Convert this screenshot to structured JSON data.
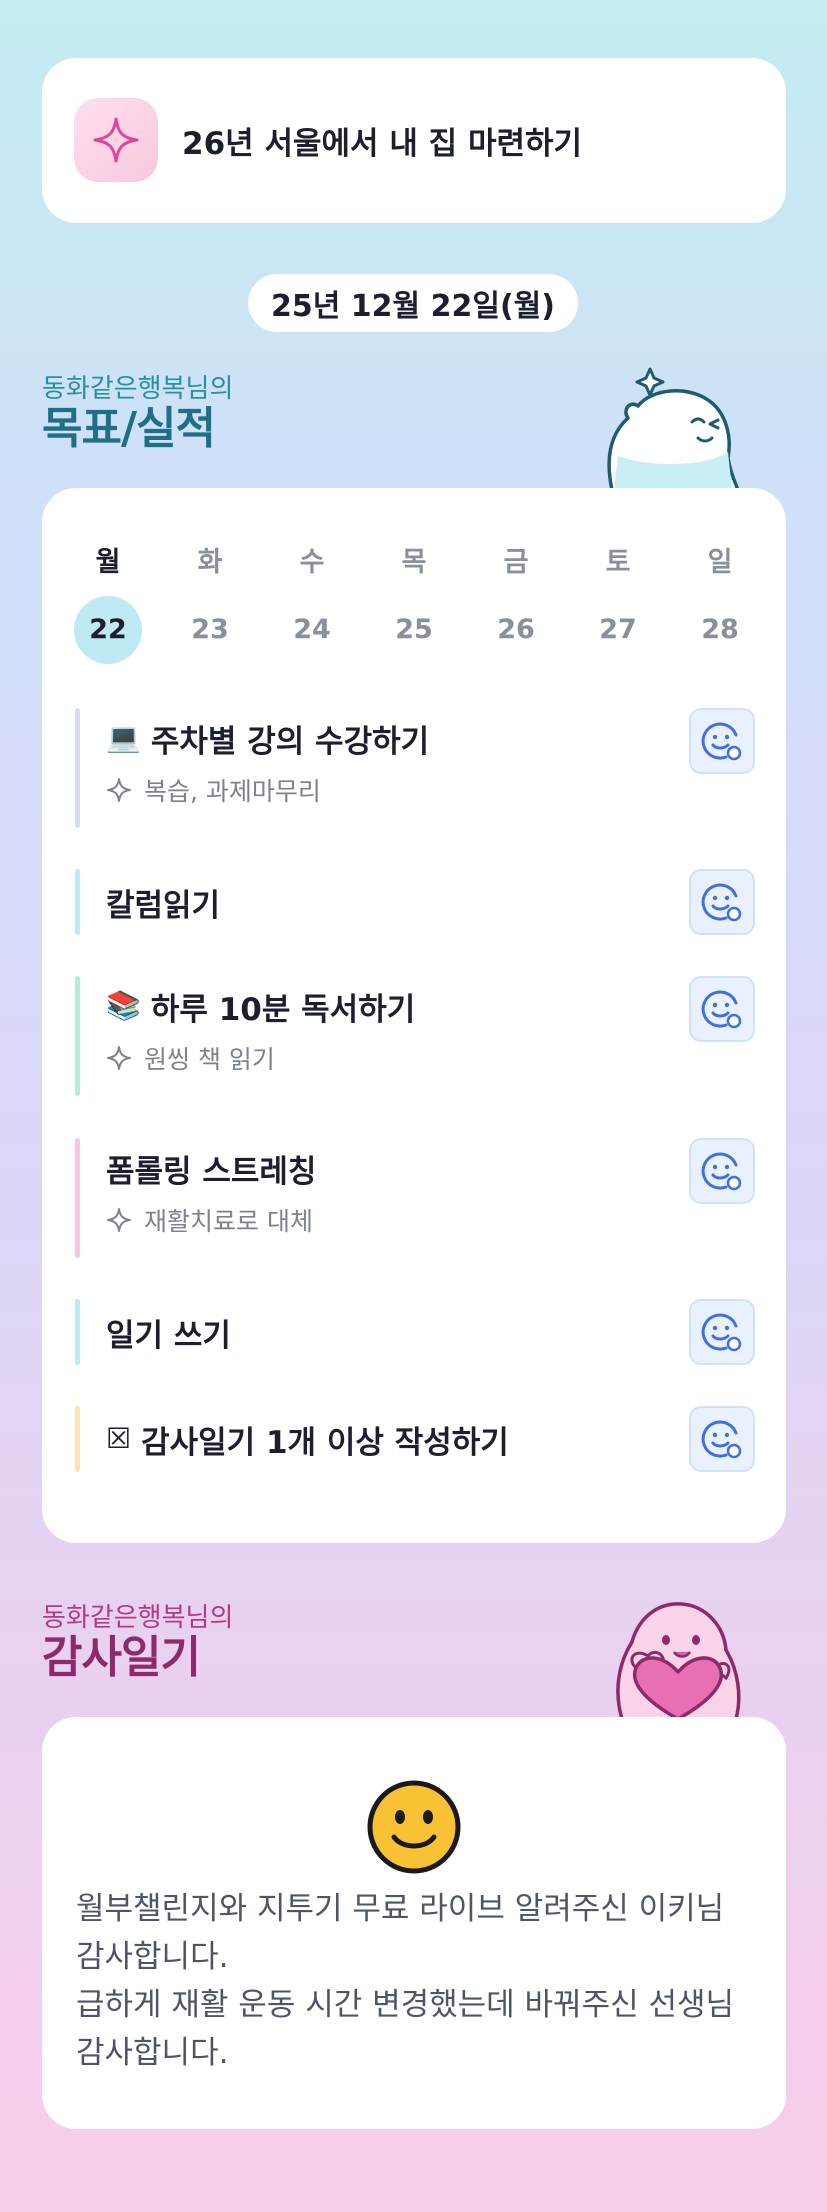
{
  "goal": {
    "text": "26년 서울에서 내 집 마련하기",
    "icon": "sparkle-icon"
  },
  "date": "25년 12월 22일(월)",
  "goals_section": {
    "subtitle": "동화같은행복님의",
    "title": "목표/실적"
  },
  "week": {
    "days": [
      "월",
      "화",
      "수",
      "목",
      "금",
      "토",
      "일"
    ],
    "dates": [
      "22",
      "23",
      "24",
      "25",
      "26",
      "27",
      "28"
    ],
    "active_index": 0
  },
  "tasks": [
    {
      "emoji": "💻",
      "title": "주차별 강의 수강하기",
      "sub": "복습, 과제마무리",
      "bar_color": "#d4dcf5"
    },
    {
      "emoji": "",
      "title": "칼럼읽기",
      "sub": "",
      "bar_color": "#bfeaf0"
    },
    {
      "emoji": "📚",
      "title": "하루 10분 독서하기",
      "sub": "원씽 책 읽기",
      "bar_color": "#b6ecd9"
    },
    {
      "emoji": "",
      "title": "폼롤링 스트레칭",
      "sub": "재활치료로 대체",
      "bar_color": "#f7c4e2"
    },
    {
      "emoji": "",
      "title": "일기 쓰기",
      "sub": "",
      "bar_color": "#bfeaf0"
    },
    {
      "emoji": "☒",
      "title": "감사일기 1개 이상 작성하기",
      "sub": "",
      "bar_color": "#fbe3b6"
    }
  ],
  "thanks_section": {
    "subtitle": "동화같은행복님의",
    "title": "감사일기"
  },
  "thanks": {
    "icon": "smiley-icon",
    "lines": [
      "월부챌린지와 지투기 무료 라이브 알려주신 이키님 감사합니다.",
      "급하게 재활 운동 시간 변경했는데 바꿔주신 선생님 감사합니다."
    ]
  },
  "colors": {
    "accent_teal": "#1f6f86",
    "accent_magenta": "#8e2a6c",
    "active_date_bg": "#bfe9f4",
    "button_blue": "#3f6fe0"
  }
}
